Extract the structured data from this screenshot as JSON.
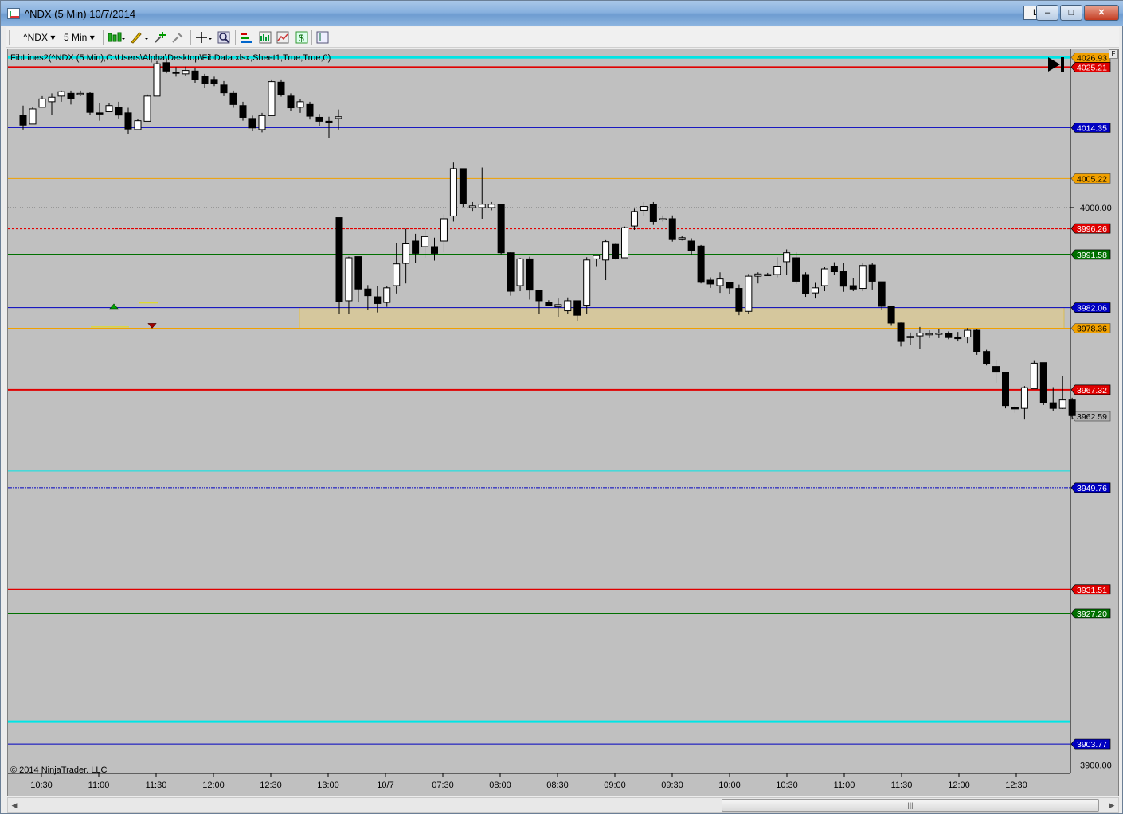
{
  "window": {
    "title": "^NDX (5 Min)  10/7/2014",
    "lbtn": "L",
    "min": "–",
    "max": "□",
    "close": "✕"
  },
  "toolbar": {
    "instrument": "^NDX",
    "interval": "5 Min",
    "dropdown": "▾"
  },
  "chart": {
    "indicator_label": "FibLines2(^NDX (5 Min),C:\\Users\\Alpha\\Desktop\\FibData.xlsx,Sheet1,True,True,0)",
    "copyright": "© 2014 NinjaTrader, LLC",
    "panel_flag": "F"
  },
  "colors": {
    "background": "#c0c0c0",
    "up_candle": "#ffffff",
    "down_candle": "#000000",
    "zone": "#d8c896"
  },
  "chart_data": {
    "type": "candlestick",
    "ylim": [
      3898.5,
      4028.4
    ],
    "x_ticks": [
      "10:30",
      "11:00",
      "11:30",
      "12:00",
      "12:30",
      "13:00",
      "10/7",
      "07:30",
      "08:00",
      "08:30",
      "09:00",
      "09:30",
      "10:00",
      "10:30",
      "11:00",
      "11:30",
      "12:00",
      "12:30"
    ],
    "y_ticks": [
      "4000.00",
      "3900.00"
    ],
    "price_levels": [
      {
        "value": 4026.93,
        "label": "4026.93",
        "color": "#00e5e5",
        "badge": "#f0a000",
        "width": 3
      },
      {
        "value": 4025.21,
        "label": "4025.21",
        "color": "#e00000",
        "badge": "#e00000",
        "width": 2
      },
      {
        "value": 4014.35,
        "label": "4014.35",
        "color": "#0000c0",
        "badge": "#0000c0",
        "width": 1
      },
      {
        "value": 4005.22,
        "label": "4005.22",
        "color": "#f0a000",
        "badge": "#f0a000",
        "width": 1
      },
      {
        "value": 3996.26,
        "label": "3996.26",
        "color": "#e00000",
        "badge": "#e00000",
        "width": 2,
        "dashed": true
      },
      {
        "value": 3991.58,
        "label": "3991.58",
        "color": "#007000",
        "badge": "#007000",
        "width": 2
      },
      {
        "value": 3982.06,
        "label": "3982.06",
        "color": "#0000c0",
        "badge": "#0000c0",
        "width": 1
      },
      {
        "value": 3978.36,
        "label": "3978.36",
        "color": "#f0a000",
        "badge": "#f0a000",
        "width": 1
      },
      {
        "value": 3967.32,
        "label": "3967.32",
        "color": "#e00000",
        "badge": "#e00000",
        "width": 2
      },
      {
        "value": 3962.59,
        "label": "3962.59",
        "color": "#808080",
        "badge": "#b0b0b0",
        "width": 0
      },
      {
        "value": 3952.76,
        "label": "",
        "color": "#00e5e5",
        "badge": "",
        "width": 1
      },
      {
        "value": 3949.76,
        "label": "3949.76",
        "color": "#0000c0",
        "badge": "#0000c0",
        "width": 1,
        "dashed": true
      },
      {
        "value": 3931.51,
        "label": "3931.51",
        "color": "#e00000",
        "badge": "#e00000",
        "width": 2
      },
      {
        "value": 3927.2,
        "label": "3927.20",
        "color": "#007000",
        "badge": "#007000",
        "width": 2
      },
      {
        "value": 3907.76,
        "label": "",
        "color": "#00e5e5",
        "badge": "",
        "width": 3
      },
      {
        "value": 3903.77,
        "label": "3903.77",
        "color": "#0000c0",
        "badge": "#0000c0",
        "width": 1
      }
    ],
    "zone": [
      3978.36,
      3982.06
    ],
    "session1_candles": [
      [
        4016.5,
        4018.3,
        4014.0,
        4014.8
      ],
      [
        4015.0,
        4018.1,
        4015.0,
        4017.7
      ],
      [
        4018.0,
        4020.0,
        4018.0,
        4019.5
      ],
      [
        4019.0,
        4020.5,
        4016.7,
        4019.8
      ],
      [
        4020.0,
        4021.0,
        4019.0,
        4020.8
      ],
      [
        4020.5,
        4021.0,
        4018.5,
        4019.6
      ],
      [
        4020.5,
        4021.0,
        4020.0,
        4020.5
      ],
      [
        4020.5,
        4020.8,
        4016.6,
        4017.1
      ],
      [
        4017.0,
        4018.8,
        4015.6,
        4016.8
      ],
      [
        4017.2,
        4018.8,
        4017.2,
        4018.3
      ],
      [
        4018.0,
        4019.0,
        4016.0,
        4016.6
      ],
      [
        4017.0,
        4017.9,
        4013.2,
        4014.1
      ],
      [
        4014.0,
        4015.9,
        4014.0,
        4015.6
      ],
      [
        4015.5,
        4020.3,
        4015.5,
        4020.0
      ],
      [
        4020.0,
        4026.3,
        4020.0,
        4025.8
      ],
      [
        4026.0,
        4026.4,
        4024.1,
        4024.5
      ],
      [
        4024.3,
        4025.2,
        4023.5,
        4024.1
      ],
      [
        4024.0,
        4025.3,
        4023.6,
        4024.6
      ],
      [
        4024.5,
        4025.0,
        4022.4,
        4023.0
      ],
      [
        4023.5,
        4024.0,
        4021.4,
        4022.3
      ],
      [
        4023.0,
        4023.5,
        4021.8,
        4022.2
      ],
      [
        4022.0,
        4022.7,
        4020.0,
        4020.6
      ],
      [
        4020.5,
        4021.0,
        4017.9,
        4018.5
      ],
      [
        4018.3,
        4019.0,
        4015.6,
        4016.2
      ],
      [
        4016.0,
        4016.5,
        4013.7,
        4014.3
      ],
      [
        4014.0,
        4017.0,
        4013.5,
        4016.5
      ],
      [
        4016.5,
        4023.0,
        4016.5,
        4022.6
      ],
      [
        4022.5,
        4023.0,
        4019.9,
        4020.3
      ],
      [
        4020.0,
        4020.5,
        4017.3,
        4017.9
      ],
      [
        4018.0,
        4019.5,
        4017.0,
        4019.0
      ],
      [
        4018.5,
        4019.0,
        4015.8,
        4016.4
      ],
      [
        4016.2,
        4016.8,
        4014.7,
        4015.5
      ],
      [
        4015.5,
        4016.3,
        4012.5,
        4015.3
      ],
      [
        4016.0,
        4017.6,
        4014.0,
        4016.3
      ]
    ],
    "session2_candles": [
      [
        3998.2,
        3998.2,
        3981.0,
        3983.1
      ],
      [
        3983.3,
        3991.2,
        3981.0,
        3991.0
      ],
      [
        3991.2,
        3991.2,
        3983.0,
        3985.4
      ],
      [
        3985.4,
        3986.1,
        3981.6,
        3984.2
      ],
      [
        3984.0,
        3986.0,
        3981.2,
        3982.8
      ],
      [
        3983.0,
        3986.0,
        3982.2,
        3985.6
      ],
      [
        3986.0,
        3993.7,
        3984.6,
        3989.9
      ],
      [
        3990.0,
        3996.2,
        3986.4,
        3993.5
      ],
      [
        3994.0,
        3995.3,
        3990.0,
        3991.8
      ],
      [
        3993.0,
        3996.2,
        3991.0,
        3994.8
      ],
      [
        3993.0,
        3994.6,
        3990.5,
        3991.8
      ],
      [
        3994.0,
        3998.8,
        3992.0,
        3998.0
      ],
      [
        3998.5,
        4008.1,
        3997.5,
        4007.0
      ],
      [
        4007.0,
        4007.0,
        4000.1,
        4000.7
      ],
      [
        4000.0,
        4001.0,
        3999.4,
        4000.3
      ],
      [
        4000.0,
        4007.2,
        3998.0,
        4000.6
      ],
      [
        4000.0,
        4001.0,
        3999.5,
        4000.6
      ],
      [
        4000.5,
        4000.5,
        3991.6,
        3991.9
      ],
      [
        3991.9,
        3992.0,
        3984.2,
        3985.0
      ],
      [
        3986.0,
        3991.0,
        3985.0,
        3990.8
      ],
      [
        3990.8,
        3991.2,
        3983.5,
        3985.2
      ],
      [
        3985.2,
        3985.2,
        3981.0,
        3983.3
      ],
      [
        3983.0,
        3983.4,
        3982.3,
        3982.5
      ],
      [
        3982.2,
        3983.7,
        3980.4,
        3982.6
      ],
      [
        3981.5,
        3983.9,
        3981.0,
        3983.3
      ],
      [
        3983.3,
        3983.3,
        3979.7,
        3980.7
      ],
      [
        3982.5,
        3991.1,
        3981.0,
        3990.6
      ],
      [
        3990.8,
        3991.5,
        3989.5,
        3991.4
      ],
      [
        3990.6,
        3994.3,
        3987.0,
        3993.9
      ],
      [
        3993.4,
        3993.5,
        3990.7,
        3990.9
      ],
      [
        3991.0,
        3996.6,
        3991.0,
        3996.4
      ],
      [
        3996.7,
        3999.8,
        3996.0,
        3999.3
      ],
      [
        3999.5,
        4001.0,
        3998.5,
        4000.2
      ],
      [
        4000.5,
        4001.0,
        3996.9,
        3997.5
      ],
      [
        3998.0,
        3998.6,
        3997.5,
        3998.0
      ],
      [
        3998.0,
        3998.6,
        3993.9,
        3994.4
      ],
      [
        3994.4,
        3995.0,
        3994.1,
        3994.6
      ],
      [
        3994.0,
        3994.5,
        3991.5,
        3992.3
      ],
      [
        3993.1,
        3993.3,
        3986.4,
        3986.6
      ],
      [
        3987.0,
        3987.5,
        3985.6,
        3986.3
      ],
      [
        3986.0,
        3988.4,
        3984.7,
        3987.2
      ],
      [
        3986.6,
        3986.6,
        3984.5,
        3985.6
      ],
      [
        3985.5,
        3986.2,
        3980.7,
        3981.4
      ],
      [
        3981.4,
        3988.1,
        3981.0,
        3987.7
      ],
      [
        3987.7,
        3988.4,
        3986.4,
        3988.1
      ],
      [
        3988.0,
        3988.3,
        3987.9,
        3988.0
      ],
      [
        3988.0,
        3991.1,
        3987.5,
        3989.5
      ],
      [
        3990.3,
        3992.5,
        3988.0,
        3991.9
      ],
      [
        3991.0,
        3992.0,
        3986.3,
        3986.8
      ],
      [
        3988.0,
        3988.4,
        3984.0,
        3984.6
      ],
      [
        3984.7,
        3986.5,
        3983.7,
        3985.6
      ],
      [
        3986.0,
        3989.4,
        3985.0,
        3989.0
      ],
      [
        3989.5,
        3990.2,
        3988.0,
        3988.5
      ],
      [
        3988.5,
        3990.0,
        3984.9,
        3985.9
      ],
      [
        3986.0,
        3987.3,
        3985.0,
        3985.4
      ],
      [
        3985.5,
        3990.0,
        3985.0,
        3989.6
      ],
      [
        3989.7,
        3990.1,
        3985.3,
        3986.8
      ],
      [
        3986.7,
        3986.7,
        3981.6,
        3982.3
      ],
      [
        3982.3,
        3982.3,
        3978.8,
        3979.3
      ],
      [
        3979.3,
        3979.4,
        3975.1,
        3976.0
      ],
      [
        3976.8,
        3977.6,
        3975.3,
        3976.9
      ],
      [
        3977.0,
        3978.6,
        3974.7,
        3977.5
      ],
      [
        3977.4,
        3978.0,
        3976.6,
        3977.4
      ],
      [
        3977.4,
        3978.3,
        3976.6,
        3977.5
      ],
      [
        3977.5,
        3977.8,
        3976.4,
        3976.7
      ],
      [
        3976.8,
        3977.7,
        3976.0,
        3976.5
      ],
      [
        3976.8,
        3978.4,
        3975.7,
        3978.0
      ],
      [
        3978.0,
        3978.2,
        3973.6,
        3974.2
      ],
      [
        3974.2,
        3974.5,
        3971.7,
        3972.0
      ],
      [
        3971.5,
        3972.7,
        3968.6,
        3970.5
      ],
      [
        3970.5,
        3970.5,
        3964.0,
        3964.5
      ],
      [
        3964.2,
        3964.5,
        3963.2,
        3963.9
      ],
      [
        3964.0,
        3968.0,
        3962.0,
        3967.7
      ],
      [
        3967.5,
        3972.5,
        3967.5,
        3972.1
      ],
      [
        3972.2,
        3972.2,
        3964.6,
        3965.0
      ],
      [
        3965.0,
        3967.8,
        3963.6,
        3964.0
      ],
      [
        3964.0,
        3969.8,
        3963.9,
        3965.5
      ],
      [
        3965.5,
        3965.9,
        3962.0,
        3962.7
      ]
    ],
    "markers": [
      {
        "type": "up-triangle",
        "x_index": 10,
        "value": 3982.3,
        "color": "#00a000"
      },
      {
        "type": "down-triangle",
        "x_index": 14,
        "value": 3978.8,
        "color": "#a00000"
      }
    ]
  }
}
